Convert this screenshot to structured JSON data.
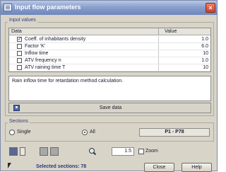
{
  "window": {
    "title": "Input flow parameters"
  },
  "input_values": {
    "group_label": "Input values",
    "columns": [
      "Data",
      "Value"
    ],
    "rows": [
      {
        "checked": true,
        "label": "Coeff. of inhabitants density",
        "value": "1.0"
      },
      {
        "checked": false,
        "label": "Factor 'K'",
        "value": "6.0"
      },
      {
        "checked": false,
        "label": "Inflow time",
        "value": "10"
      },
      {
        "checked": false,
        "label": "ATV frequency n",
        "value": "1.0"
      },
      {
        "checked": false,
        "label": "ATV raining time T",
        "value": "10"
      }
    ],
    "description": "Rain inflow time for retardation method calculation."
  },
  "save": {
    "label": "Save data",
    "icon": "floppy-disk-icon"
  },
  "sections": {
    "group_label": "Sections",
    "options": [
      {
        "label": "Single",
        "selected": false
      },
      {
        "label": "All",
        "selected": true
      }
    ],
    "range": "P1 - P78"
  },
  "toolbar": {
    "zoom_value": "1.5",
    "zoom_label": "Zoom",
    "zoom_checked": false
  },
  "footer": {
    "selected_text": "Selected sections: 78",
    "close_label": "Close",
    "help_label": "Help"
  }
}
